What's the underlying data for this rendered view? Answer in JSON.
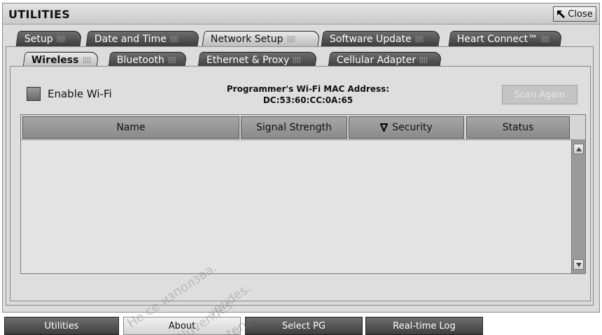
{
  "window": {
    "title": "UTILITIES",
    "close_label": "Close"
  },
  "tabs": [
    {
      "label": "Setup",
      "active": false
    },
    {
      "label": "Date and Time",
      "active": false
    },
    {
      "label": "Network Setup",
      "active": true
    },
    {
      "label": "Software Update",
      "active": false
    },
    {
      "label": "Heart Connect™",
      "active": false
    }
  ],
  "subtabs": [
    {
      "label": "Wireless",
      "active": true
    },
    {
      "label": "Bluetooth",
      "active": false
    },
    {
      "label": "Ethernet & Proxy",
      "active": false
    },
    {
      "label": "Cellular Adapter",
      "active": false
    }
  ],
  "wireless": {
    "enable_label": "Enable Wi-Fi",
    "enabled": false,
    "mac_title": "Programmer's Wi-Fi MAC Address:",
    "mac_value": "DC:53:60:CC:0A:65",
    "scan_label": "Scan Again"
  },
  "table": {
    "columns": [
      "Name",
      "Signal Strength",
      "Security",
      "Status"
    ],
    "sort_column": "Security",
    "rows": []
  },
  "bottom_nav": [
    "Utilities",
    "About",
    "Select PG",
    "Real-time Log"
  ],
  "watermark": [
    "Не се използва.",
    "vendes.",
    "Nuvendes.",
    "ten."
  ],
  "colors": {
    "tab_dark": "#4a4a4a",
    "tab_active": "#d6d6d6",
    "panel": "#dcdcdc"
  }
}
